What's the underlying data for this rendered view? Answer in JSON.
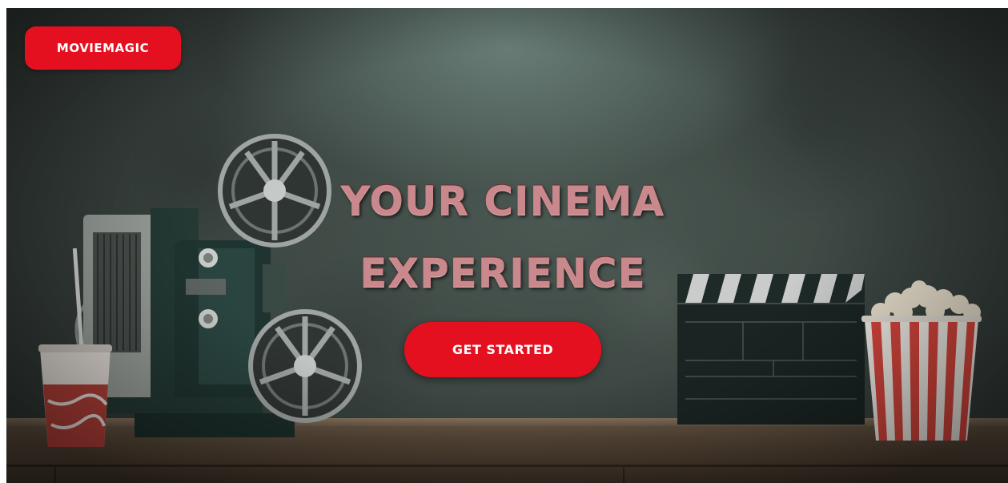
{
  "header": {
    "brand_label": "MOVIEMAGIC"
  },
  "hero": {
    "title_line1": "YOUR CINEMA",
    "title_line2": "EXPERIENCE",
    "cta_label": "GET STARTED"
  },
  "colors": {
    "accent": "#e5101f",
    "title_text": "#c9888c",
    "wall": "#3d4743"
  },
  "background_props": {
    "items": [
      "film-projector",
      "paper-cup",
      "clapperboard",
      "popcorn-bucket",
      "wooden-table"
    ]
  }
}
